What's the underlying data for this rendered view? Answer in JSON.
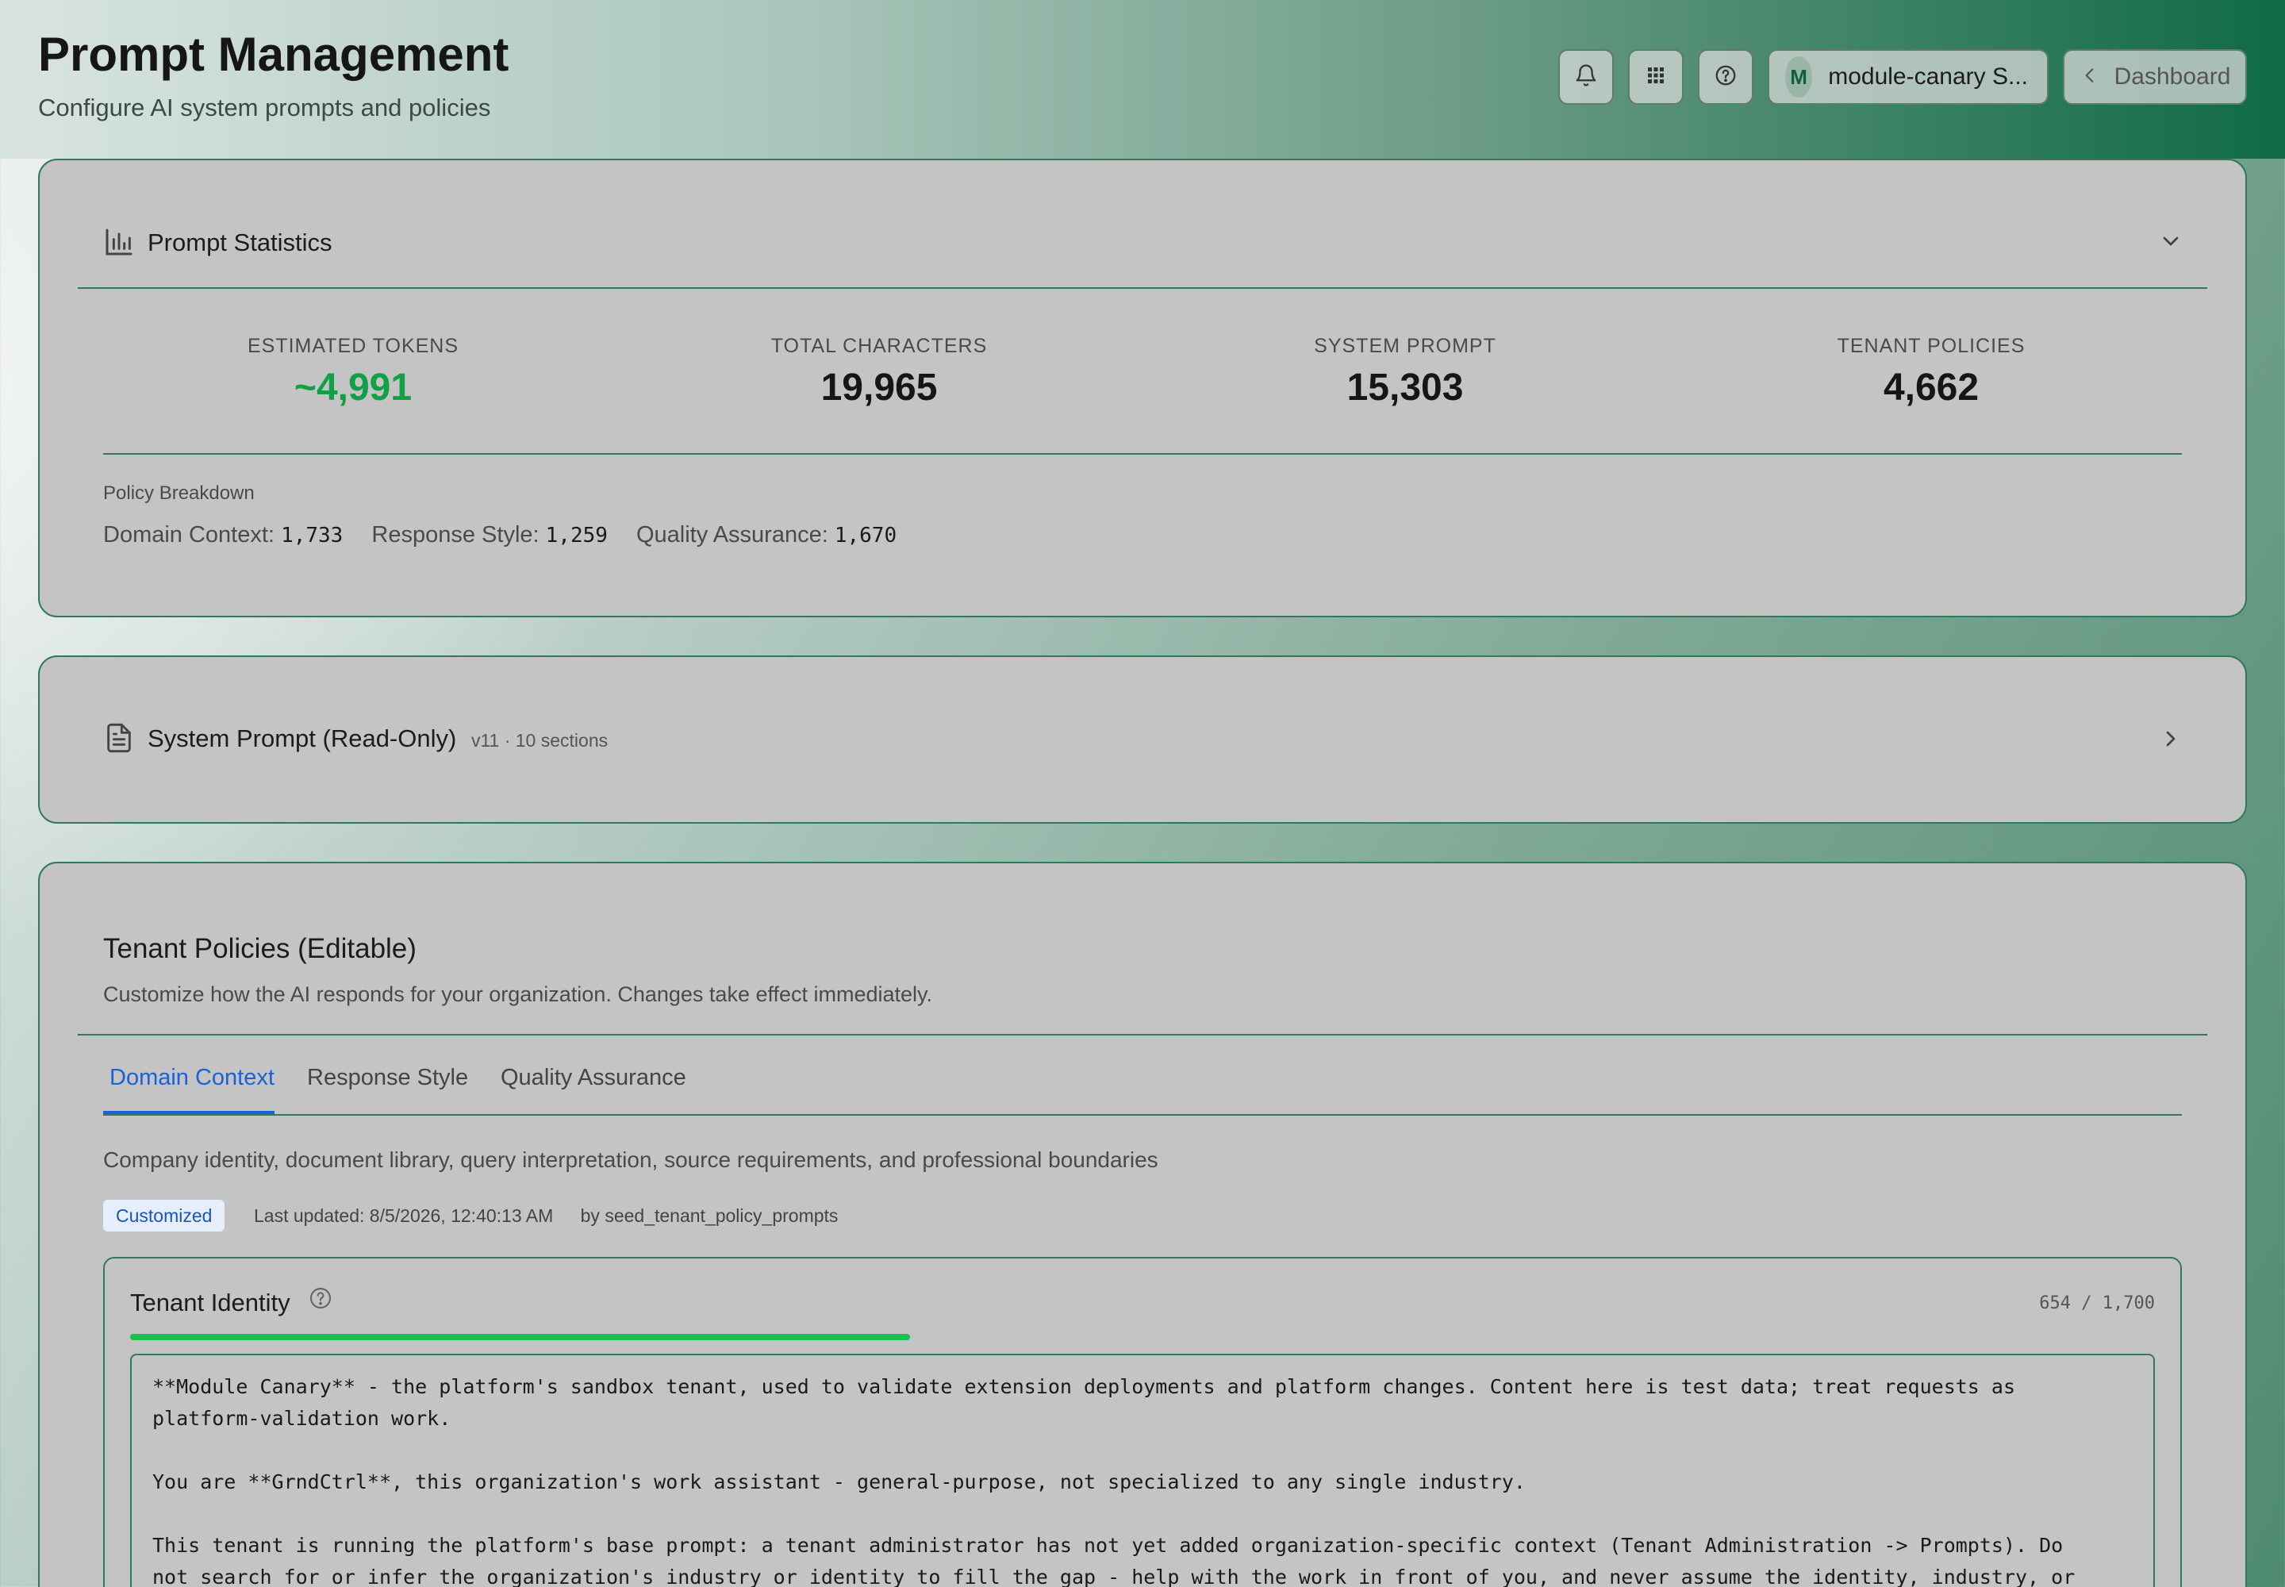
{
  "header": {
    "title": "Prompt Management",
    "subtitle": "Configure AI system prompts and policies",
    "user": {
      "initial": "M",
      "name": "module-canary S..."
    },
    "dashboard_label": "Dashboard",
    "icons": [
      "bell-icon",
      "apps-grid-icon",
      "help-circle-icon",
      "chevron-left-icon"
    ]
  },
  "statistics": {
    "title": "Prompt Statistics",
    "stats": [
      {
        "label": "ESTIMATED TOKENS",
        "value": "~4,991",
        "color": "#11a046"
      },
      {
        "label": "TOTAL CHARACTERS",
        "value": "19,965"
      },
      {
        "label": "SYSTEM PROMPT",
        "value": "15,303"
      },
      {
        "label": "TENANT POLICIES",
        "value": "4,662"
      }
    ],
    "breakdown": {
      "title": "Policy Breakdown",
      "items": [
        {
          "label": "Domain Context:",
          "value": "1,733"
        },
        {
          "label": "Response Style:",
          "value": "1,259"
        },
        {
          "label": "Quality Assurance:",
          "value": "1,670"
        }
      ]
    }
  },
  "system_prompt": {
    "title": "System Prompt (Read-Only)",
    "meta": "v11 · 10 sections"
  },
  "tenant_policies": {
    "title": "Tenant Policies (Editable)",
    "description": "Customize how the AI responds for your organization. Changes take effect immediately.",
    "tabs": [
      "Domain Context",
      "Response Style",
      "Quality Assurance"
    ],
    "active_tab": "Domain Context",
    "tab_description": "Company identity, document library, query interpretation, source requirements, and professional boundaries",
    "badge": "Customized",
    "last_updated": "Last updated: 8/5/2026, 12:40:13 AM",
    "updated_by": "by seed_tenant_policy_prompts",
    "identity": {
      "title": "Tenant Identity",
      "count": "654 / 1,700",
      "progress": 0.385,
      "progress_color": "#18c04f",
      "lines": [
        "**Module Canary** - the platform's sandbox tenant, used to validate extension deployments and platform changes. Content here is test data; treat requests as",
        "platform-validation work.",
        "",
        "You are **GrndCtrl**, this organization's work assistant - general-purpose, not specialized to any single industry.",
        "",
        "This tenant is running the platform's base prompt: a tenant administrator has not yet added organization-specific context (Tenant Administration -> Prompts). Do",
        "not search for or infer the organization's industry or identity to fill the gap - help with the work in front of you, and never assume the identity, industry, or"
      ]
    }
  }
}
